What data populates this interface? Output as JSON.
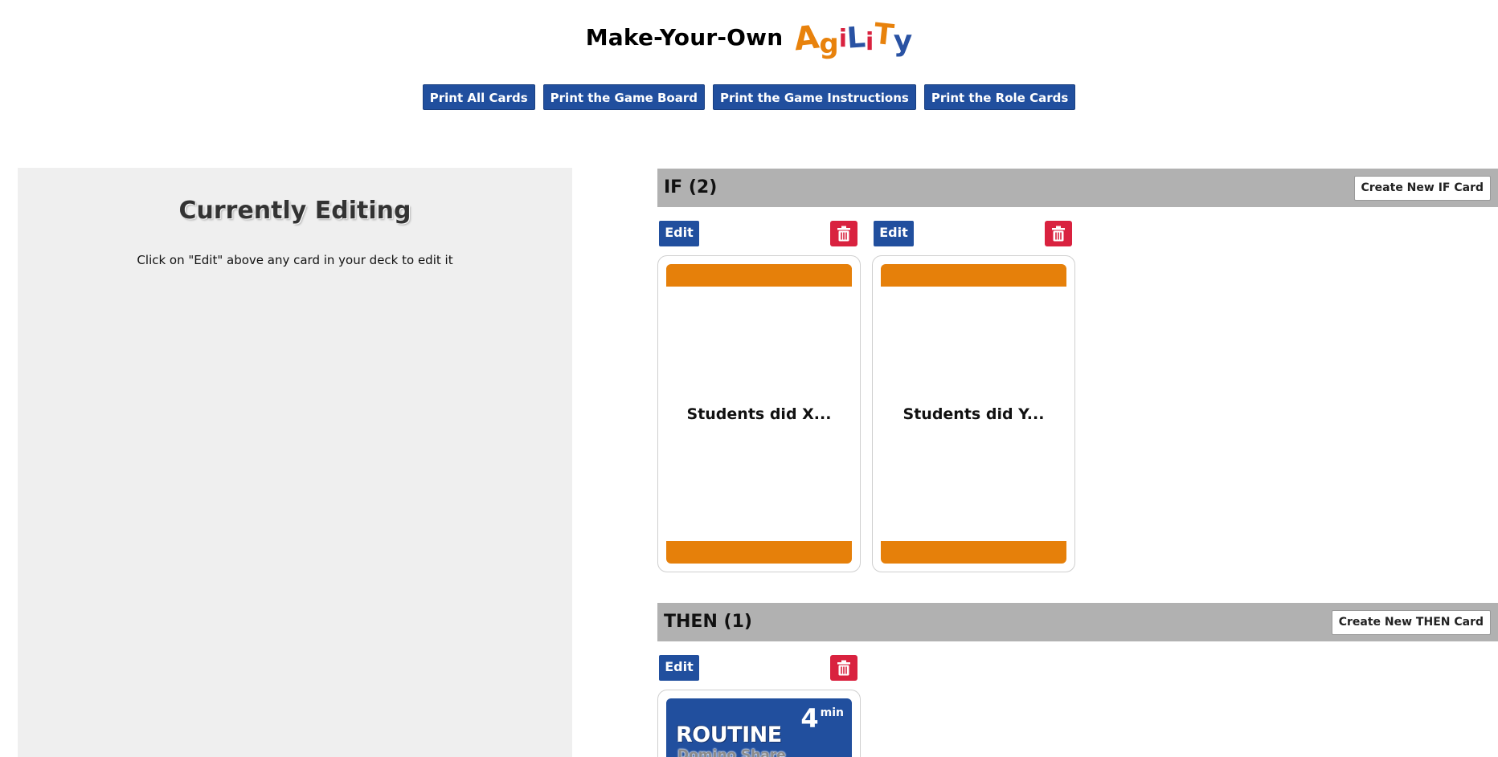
{
  "header": {
    "title": "Make-Your-Own",
    "logo_letters": [
      "A",
      "g",
      "i",
      "L",
      "i",
      "T",
      "y"
    ]
  },
  "print_buttons": [
    {
      "label": "Print All Cards"
    },
    {
      "label": "Print the Game Board"
    },
    {
      "label": "Print the Game Instructions"
    },
    {
      "label": "Print the Role Cards"
    }
  ],
  "editor": {
    "title": "Currently Editing",
    "hint": "Click on \"Edit\" above any card in your deck to edit it"
  },
  "if_section": {
    "title": "IF (2)",
    "create_label": "Create New IF Card",
    "cards": [
      {
        "edit_label": "Edit",
        "text": "Students did X..."
      },
      {
        "edit_label": "Edit",
        "text": "Students did Y..."
      }
    ]
  },
  "then_section": {
    "title": "THEN (1)",
    "create_label": "Create New THEN Card",
    "cards": [
      {
        "edit_label": "Edit",
        "label": "ROUTINE",
        "time": "4",
        "time_unit": "min",
        "subtitle": "Domino Share"
      }
    ]
  },
  "colors": {
    "primary_blue": "#214f9e",
    "danger_red": "#d9223f",
    "if_orange": "#e6800a",
    "section_gray": "#b1b1b1",
    "panel_gray": "#efefef"
  },
  "icons": {
    "delete": "trash-icon"
  }
}
